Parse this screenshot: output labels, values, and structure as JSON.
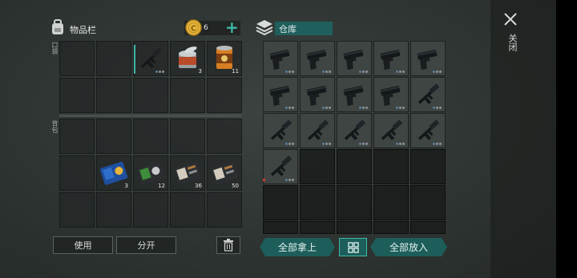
{
  "inventory": {
    "title": "物品栏",
    "coins": "6",
    "pocket_label": "口袋",
    "backpack_label": "背包",
    "pocket_items": [
      {
        "name": "rifle",
        "count": ""
      },
      {
        "name": "canned-food",
        "count": "3"
      },
      {
        "name": "canned-food-orange",
        "count": "11"
      }
    ],
    "backpack_items": [
      {
        "name": "card-blue",
        "count": "3"
      },
      {
        "name": "card-green",
        "count": "12"
      },
      {
        "name": "card-brown",
        "count": "36"
      },
      {
        "name": "card-brown-2",
        "count": "50"
      }
    ],
    "use_label": "使用",
    "split_label": "分开"
  },
  "warehouse": {
    "title": "仓库",
    "take_all_label": "全部拿上",
    "put_all_label": "全部放入"
  },
  "close_label": "关闭",
  "colors": {
    "accent": "#1d5d5a",
    "plus": "#3fb8a8",
    "coin": "#e6b43a"
  }
}
